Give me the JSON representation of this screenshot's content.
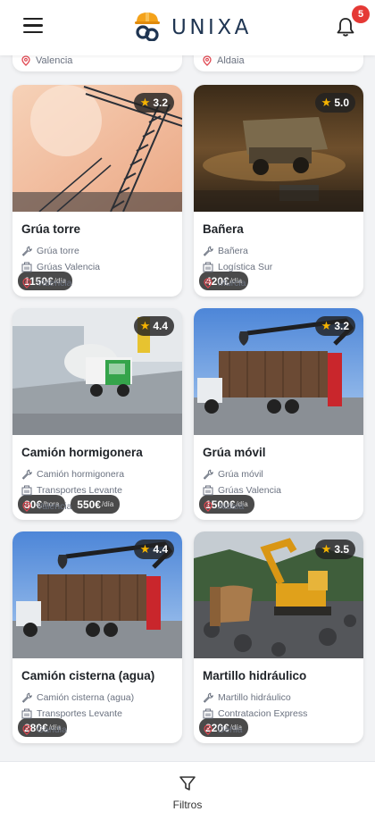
{
  "header": {
    "brand": "UNIXA",
    "notifications_count": "5",
    "icons": [
      "menu-icon",
      "logo-helmet-icon",
      "bell-icon"
    ]
  },
  "top_strip": {
    "left_location": "Valencia",
    "right_location": "Aldaia"
  },
  "listings": [
    {
      "title": "Grúa torre",
      "category": "Grúa torre",
      "company": "Grúas Valencia",
      "location": "Valencia",
      "rating": "3.2",
      "prices": [
        {
          "amount": "1150€",
          "unit": "/día"
        }
      ]
    },
    {
      "title": "Bañera",
      "category": "Bañera",
      "company": "Logística Sur",
      "location": "Murcia",
      "rating": "5.0",
      "prices": [
        {
          "amount": "420€",
          "unit": "/día"
        }
      ]
    },
    {
      "title": "Camión hormigonera",
      "category": "Camión hormigonera",
      "company": "Transportes Levante",
      "location": "Valencia",
      "rating": "4.4",
      "prices": [
        {
          "amount": "80€",
          "unit": "/hora"
        },
        {
          "amount": "550€",
          "unit": "/día"
        }
      ]
    },
    {
      "title": "Grúa móvil",
      "category": "Grúa móvil",
      "company": "Grúas Valencia",
      "location": "Aldaia",
      "rating": "3.2",
      "prices": [
        {
          "amount": "1500€",
          "unit": "/día"
        }
      ]
    },
    {
      "title": "Camión cisterna (agua)",
      "category": "Camión cisterna (agua)",
      "company": "Transportes Levante",
      "location": "Gandia",
      "rating": "4.4",
      "prices": [
        {
          "amount": "280€",
          "unit": "/día"
        }
      ]
    },
    {
      "title": "Martillo hidráulico",
      "category": "Martillo hidráulico",
      "company": "Contratacion Express",
      "location": "Denia",
      "rating": "3.5",
      "prices": [
        {
          "amount": "220€",
          "unit": "/día"
        }
      ]
    }
  ],
  "footer": {
    "filter_label": "Filtros"
  },
  "colors": {
    "accent_red": "#e53935",
    "pin_red": "#e0454f",
    "brand_navy": "#1f3552",
    "star": "#f5b301"
  }
}
